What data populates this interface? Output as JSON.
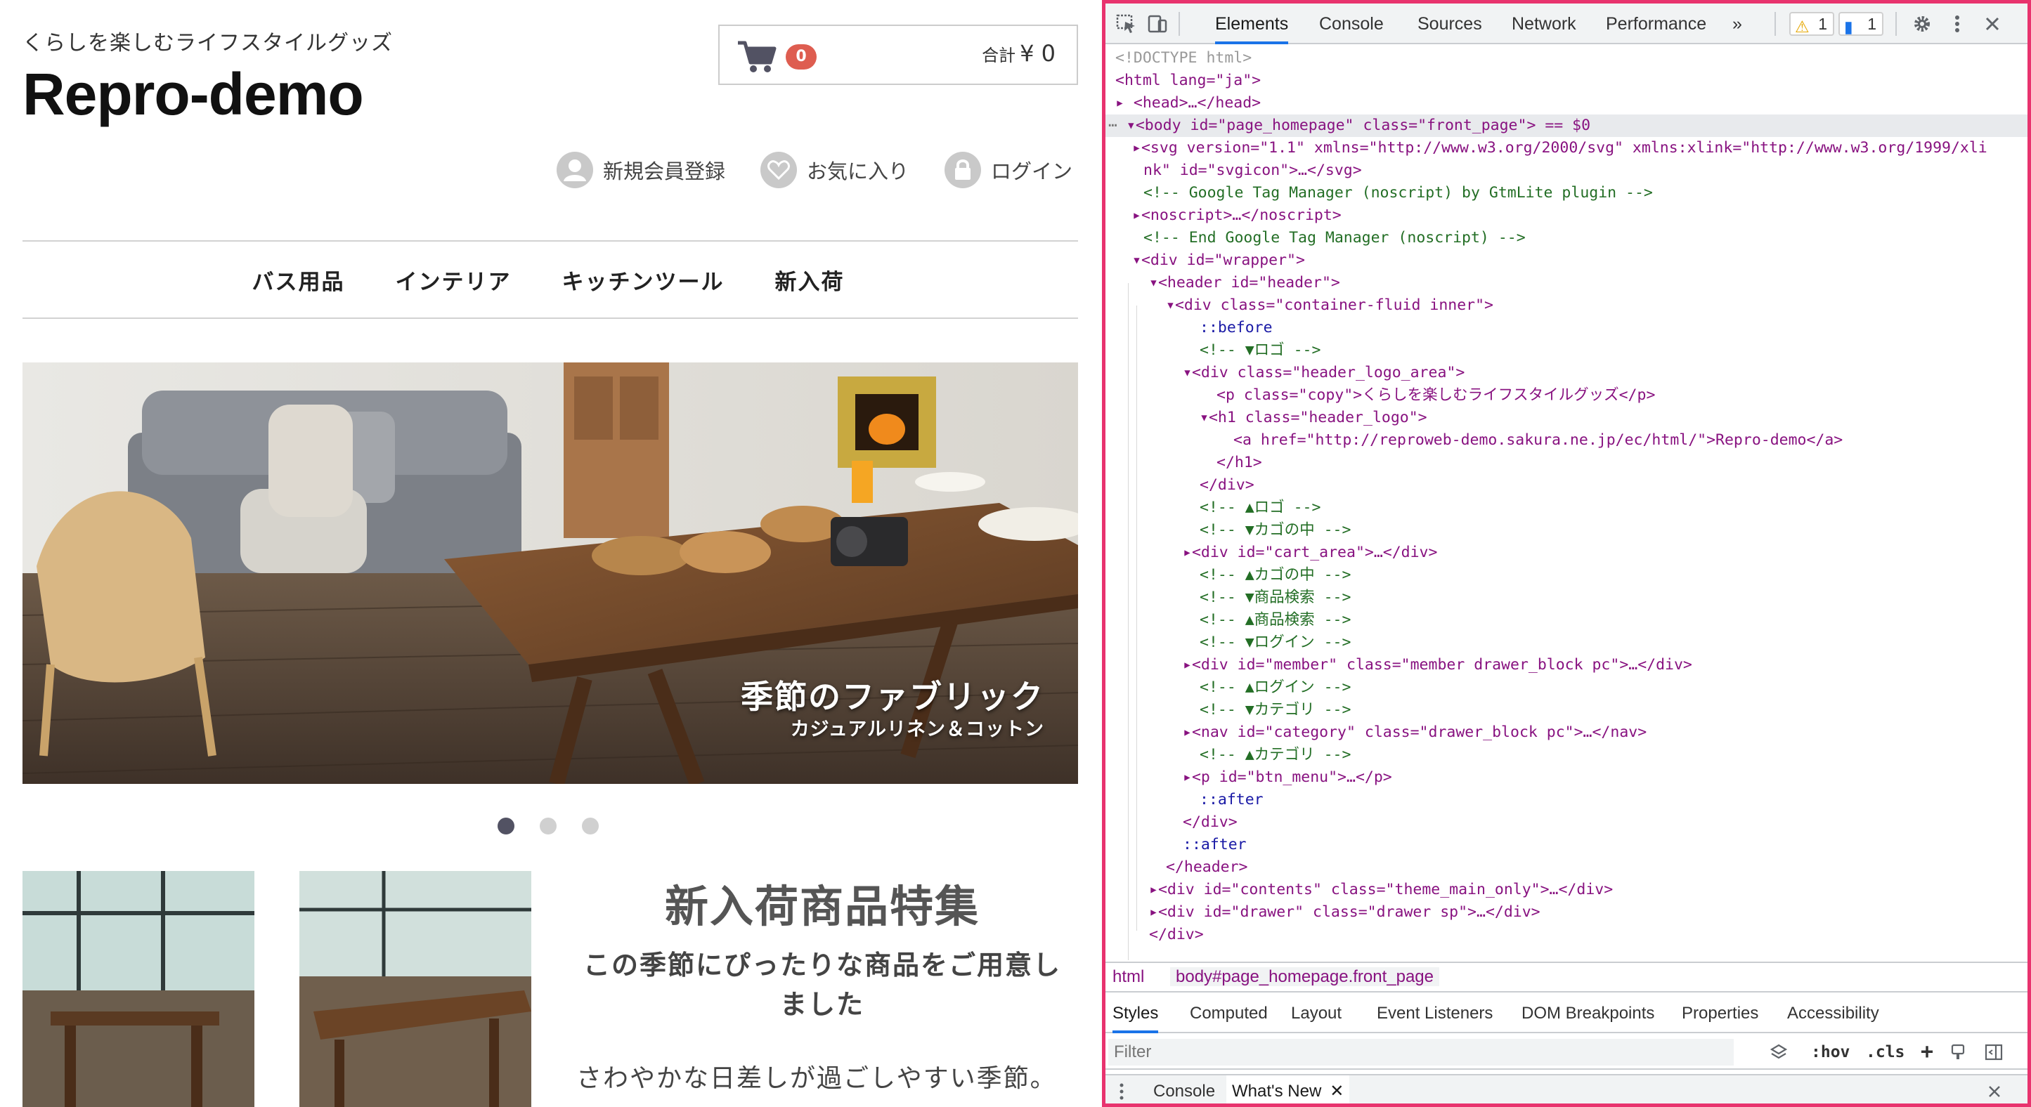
{
  "site": {
    "copy": "くらしを楽しむライフスタイルグッズ",
    "logo": "Repro-demo",
    "cart": {
      "count": "0",
      "total_label": "合計",
      "total_value": "¥ 0"
    },
    "member_links": [
      {
        "label": "新規会員登録",
        "icon": "user-icon"
      },
      {
        "label": "お気に入り",
        "icon": "heart-icon"
      },
      {
        "label": "ログイン",
        "icon": "lock-icon"
      }
    ],
    "nav": [
      "バス用品",
      "インテリア",
      "キッチンツール",
      "新入荷"
    ],
    "hero": {
      "title": "季節のファブリック",
      "subtitle": "カジュアルリネン＆コットン",
      "slides": 3,
      "active_slide": 1
    },
    "feature": {
      "title": "新入荷商品特集",
      "subtitle": "この季節にぴったりな商品をご用意しました",
      "body": "さわやかな日差しが過ごしやすい季節。"
    }
  },
  "devtools": {
    "tabs": [
      "Elements",
      "Console",
      "Sources",
      "Network",
      "Performance"
    ],
    "active_tab": "Elements",
    "more_tabs": "»",
    "warnings": "1",
    "messages": "1",
    "dom_lines": [
      "<!DOCTYPE html>",
      "<html lang=\"ja\">",
      "<head>…</head>",
      "<body id=\"page_homepage\" class=\"front_page\"> == $0",
      "<svg version=\"1.1\" xmlns=\"http://www.w3.org/2000/svg\" xmlns:xlink=\"http://www.w3.org/1999/xli",
      "nk\" id=\"svgicon\">…</svg>",
      "<!-- Google Tag Manager (noscript) by GtmLite plugin -->",
      "<noscript>…</noscript>",
      "<!-- End Google Tag Manager (noscript) -->",
      "<div id=\"wrapper\">",
      "<header id=\"header\">",
      "<div class=\"container-fluid inner\">",
      "::before",
      "<!-- ▼ロゴ -->",
      "<div class=\"header_logo_area\">",
      "<p class=\"copy\">くらしを楽しむライフスタイルグッズ</p>",
      "<h1 class=\"header_logo\">",
      "<a href=\"http://reproweb-demo.sakura.ne.jp/ec/html/\">Repro-demo</a>",
      "</h1>",
      "</div>",
      "<!-- ▲ロゴ -->",
      "<!-- ▼カゴの中 -->",
      "<div id=\"cart_area\">…</div>",
      "<!-- ▲カゴの中 -->",
      "<!-- ▼商品検索 -->",
      "<!-- ▲商品検索 -->",
      "<!-- ▼ログイン -->",
      "<div id=\"member\" class=\"member drawer_block pc\">…</div>",
      "<!-- ▲ログイン -->",
      "<!-- ▼カテゴリ -->",
      "<nav id=\"category\" class=\"drawer_block pc\">…</nav>",
      "<!-- ▲カテゴリ -->",
      "<p id=\"btn_menu\">…</p>",
      "::after",
      "</div>",
      "::after",
      "</header>",
      "<div id=\"contents\" class=\"theme_main_only\">…</div>",
      "<div id=\"drawer\" class=\"drawer sp\">…</div>",
      "</div>"
    ],
    "breadcrumbs": [
      "html",
      "body#page_homepage.front_page"
    ],
    "sub_tabs": [
      "Styles",
      "Computed",
      "Layout",
      "Event Listeners",
      "DOM Breakpoints",
      "Properties",
      "Accessibility"
    ],
    "active_sub_tab": "Styles",
    "filter_placeholder": "Filter",
    "filter_tools": [
      ":hov",
      ".cls",
      "+"
    ],
    "drawer_tabs": [
      "Console",
      "What's New"
    ],
    "active_drawer_tab": "What's New",
    "colors": {
      "highlight_border": "#e8336e",
      "accent": "#1a73e8",
      "badge": "#de5d50"
    }
  }
}
